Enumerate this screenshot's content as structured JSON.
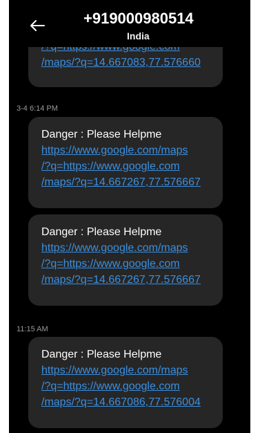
{
  "header": {
    "back_icon": "arrow-left-icon",
    "contact_number": "+919000980514",
    "contact_country": "India"
  },
  "conversation": {
    "partial_message": {
      "link_lines": [
        "/?q=https://www.google.com",
        "/maps/?q=14.667083,77.576660"
      ]
    },
    "groups": [
      {
        "timestamp": "3-4 6:14 PM",
        "messages": [
          {
            "text": "Danger : Please Helpme",
            "link_lines": [
              "https://www.google.com/maps",
              "/?q=https://www.google.com",
              "/maps/?q=14.667267,77.576667"
            ]
          },
          {
            "text": "Danger : Please Helpme",
            "link_lines": [
              "https://www.google.com/maps",
              "/?q=https://www.google.com",
              "/maps/?q=14.667267,77.576667"
            ]
          }
        ]
      },
      {
        "timestamp": "11:15 AM",
        "messages": [
          {
            "text": "Danger : Please Helpme",
            "link_lines": [
              "https://www.google.com/maps",
              "/?q=https://www.google.com",
              "/maps/?q=14.667086,77.576004"
            ]
          }
        ]
      }
    ]
  },
  "colors": {
    "background": "#000000",
    "bubble": "#262626",
    "link": "#3b8fe0",
    "timestamp": "#9a9a9a"
  }
}
